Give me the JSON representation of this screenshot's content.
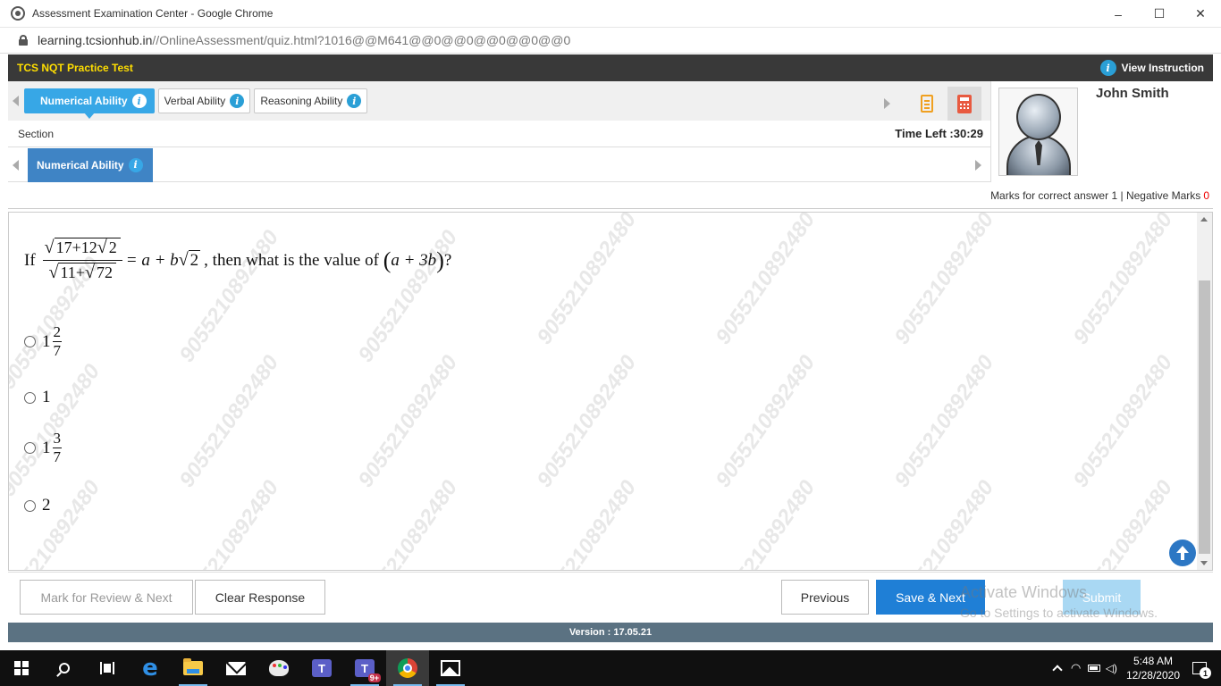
{
  "window": {
    "title": "Assessment Examination Center - Google Chrome",
    "controls": {
      "minimize": "–",
      "maximize": "☐",
      "close": "✕"
    }
  },
  "address_bar": {
    "host": "learning.tcsionhub.in",
    "path": "//OnlineAssessment/quiz.html?1016@@M641@@0@@0@@0@@0@@0"
  },
  "header": {
    "test_title": "TCS NQT Practice Test",
    "view_instruction": "View Instruction",
    "info_glyph": "i"
  },
  "section_tabs": [
    {
      "label": "Numerical Ability",
      "active": true
    },
    {
      "label": "Verbal Ability",
      "active": false
    },
    {
      "label": "Reasoning Ability",
      "active": false
    }
  ],
  "section_row": {
    "label": "Section",
    "time_left": "Time Left :30:29"
  },
  "subsection": {
    "label": "Numerical Ability"
  },
  "profile": {
    "name": "John Smith"
  },
  "marks": {
    "correct_label": "Marks for correct answer",
    "correct_value": "1",
    "separator": "|",
    "negative_label": "Negative Marks",
    "negative_value": "0"
  },
  "question": {
    "prefix": "If",
    "num_a": "17",
    "num_plus": "+12",
    "num_root": "2",
    "den_a": "11",
    "den_plus": "+",
    "den_root": "72",
    "equals": "= a + b",
    "rhs_root": "2",
    "suffix": ", then what is the value of",
    "target": "a + 3b",
    "question_mark": "?"
  },
  "options": [
    {
      "whole": "1",
      "numerator": "2",
      "denominator": "7"
    },
    {
      "whole": "1",
      "numerator": "",
      "denominator": ""
    },
    {
      "whole": "1",
      "numerator": "3",
      "denominator": "7"
    },
    {
      "whole": "2",
      "numerator": "",
      "denominator": ""
    }
  ],
  "watermark_text": "9055210892480",
  "actions": {
    "mark_review": "Mark for Review & Next",
    "clear_response": "Clear Response",
    "previous": "Previous",
    "save_next": "Save & Next",
    "submit": "Submit"
  },
  "windows_activation": {
    "title": "Activate Windows",
    "subtitle": "Go to Settings to activate Windows."
  },
  "version": "Version : 17.05.21",
  "taskbar": {
    "teams_badge": "9+",
    "clock_time": "5:48 AM",
    "clock_date": "12/28/2020",
    "notification_count": "1",
    "edge_glyph": "e",
    "teams_glyph": "T"
  },
  "colors": {
    "test_title": "#ffde00",
    "active_tab": "#37a7e6",
    "subsection_tab": "#3f84c5",
    "save_next": "#1f7fd6",
    "submit": "#a9d8f3",
    "negative_marks": "#ee0000",
    "version_bar": "#5b7282"
  },
  "icons": [
    "app-icon",
    "lock-icon",
    "info-icon",
    "notepad-icon",
    "calculator-icon",
    "avatar-icon",
    "scroll-top-icon",
    "windows-icon",
    "search-icon",
    "task-view-icon",
    "edge-icon",
    "file-explorer-icon",
    "mail-icon",
    "paint-icon",
    "teams-icon",
    "chrome-icon",
    "photos-icon"
  ]
}
